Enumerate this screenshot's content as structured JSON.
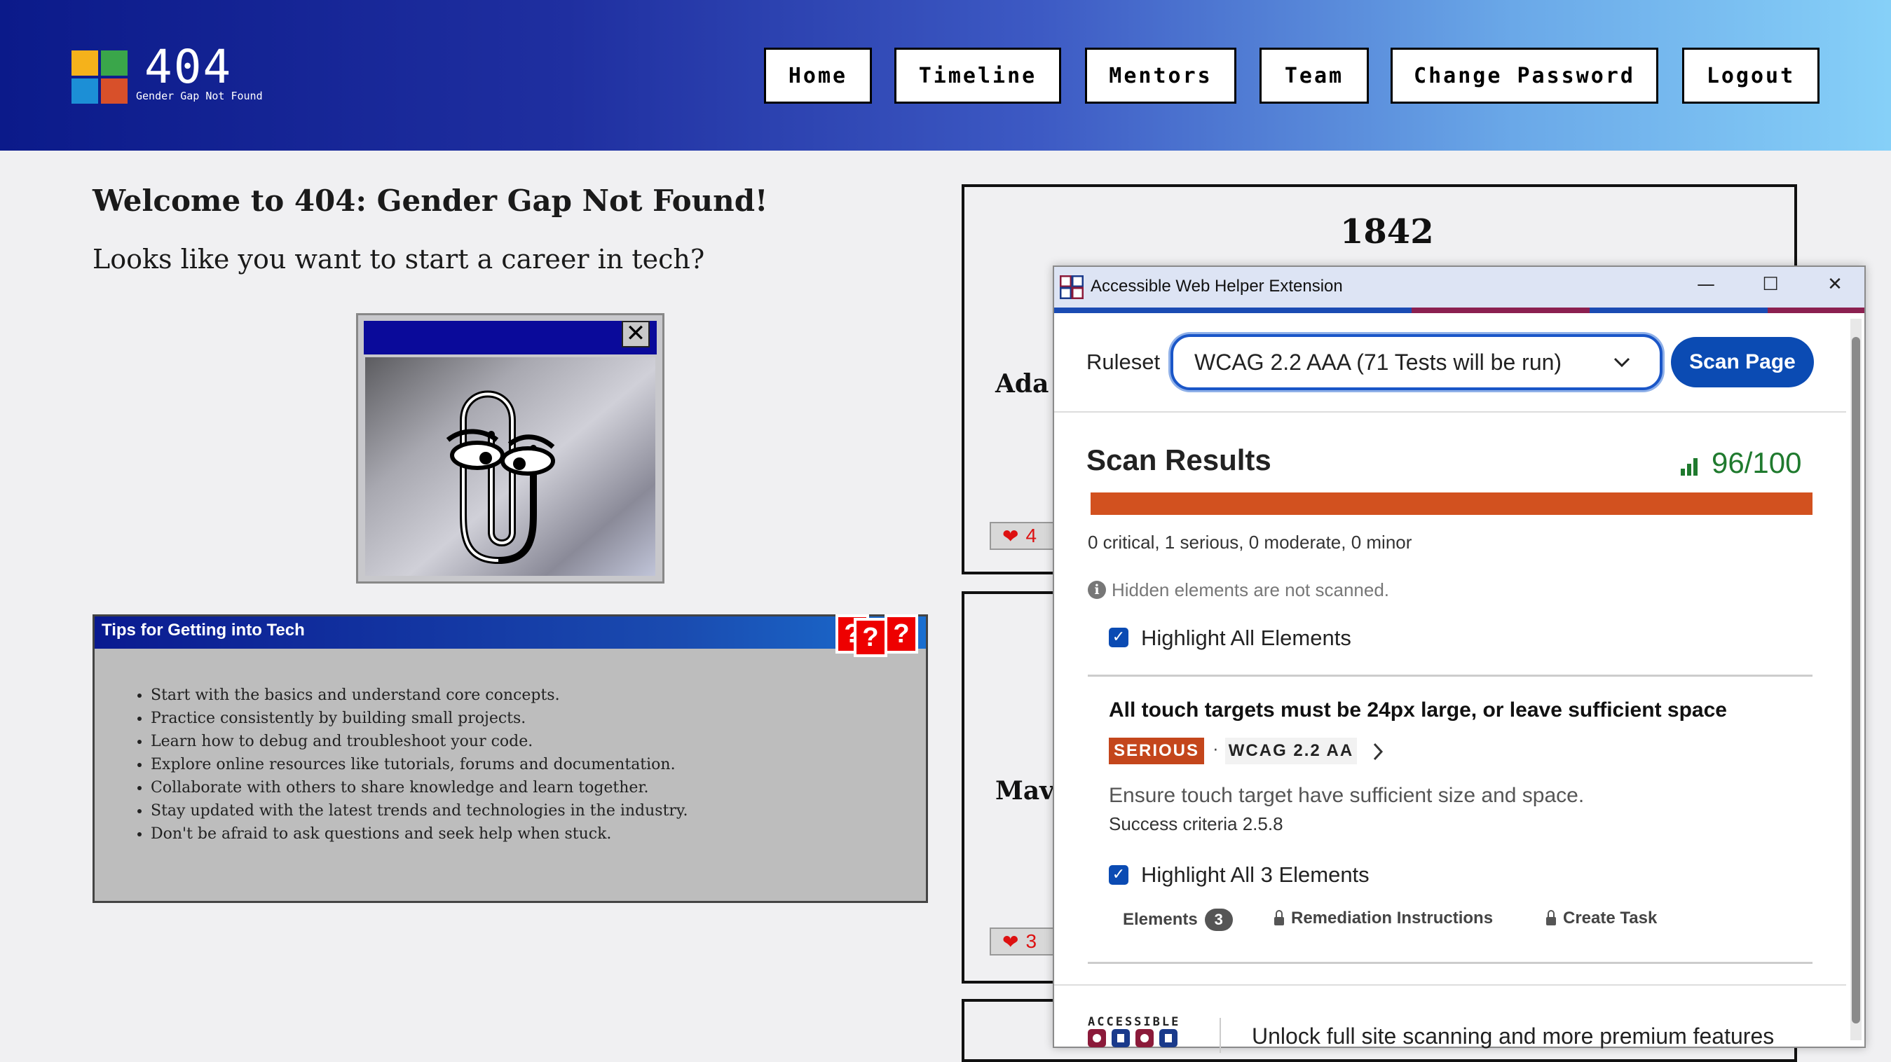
{
  "logo": {
    "title": "404",
    "subtitle": "Gender Gap Not Found"
  },
  "nav": [
    "Home",
    "Timeline",
    "Mentors",
    "Team",
    "Change Password",
    "Logout"
  ],
  "main": {
    "welcome": "Welcome to 404: Gender Gap Not Found!",
    "tagline": "Looks like you want to start a career in tech?",
    "clippy_close": "✕",
    "tips_title": "Tips for Getting into Tech",
    "tips": [
      "Start with the basics and understand core concepts.",
      "Practice consistently by building small projects.",
      "Learn how to debug and troubleshoot your code.",
      "Explore online resources like tutorials, forums and documentation.",
      "Collaborate with others to share knowledge and learn together.",
      "Stay updated with the latest trends and technologies in the industry.",
      "Don't be afraid to ask questions and seek help when stuck."
    ],
    "question_marks": [
      "?",
      "?",
      "?"
    ]
  },
  "timeline": {
    "year": "1842",
    "cards": [
      {
        "name": "Ada",
        "likes": "4"
      },
      {
        "name": "Mavi",
        "likes": "3"
      }
    ]
  },
  "extension": {
    "title": "Accessible Web Helper Extension",
    "ruleset_label": "Ruleset",
    "ruleset_value": "WCAG 2.2 AAA (71 Tests will be run)",
    "scan_button": "Scan Page",
    "results_title": "Scan Results",
    "score": "96/100",
    "summary": "0 critical, 1 serious, 0 moderate, 0 minor",
    "hidden_note": "Hidden elements are not scanned.",
    "highlight_all": "Highlight All Elements",
    "issue": {
      "title": "All touch targets must be 24px large, or leave sufficient space",
      "severity": "SERIOUS",
      "separator": "·",
      "standard": "WCAG 2.2 AA",
      "description": "Ensure touch target have sufficient size and space.",
      "criteria": "Success criteria 2.5.8",
      "highlight": "Highlight All 3 Elements",
      "tabs": {
        "elements": "Elements",
        "elements_count": "3",
        "remediation": "Remediation Instructions",
        "task": "Create Task"
      }
    },
    "promo_logo_text": "ACCESSIBLE",
    "promo": "Unlock full site scanning and more premium features",
    "colors": {
      "accent": "#0b4bb3",
      "serious": "#c4461c",
      "score_green": "#1f7a2e",
      "bar": "#d2511f"
    }
  }
}
